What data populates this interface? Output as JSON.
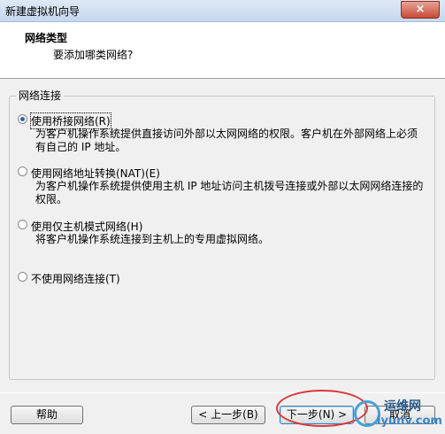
{
  "window": {
    "title": "新建虚拟机向导",
    "close_glyph": "×"
  },
  "header": {
    "title": "网络类型",
    "subtitle": "要添加哪类网络?"
  },
  "group": {
    "label": "网络连接"
  },
  "options": [
    {
      "label": "使用桥接网络(R)",
      "checked": true,
      "desc_lines": [
        "为客户机操作系统提供直接访问外部以太网网络的权限。客户机在外部网络上必须",
        "有自己的 IP 地址。"
      ]
    },
    {
      "label": "使用网络地址转换(NAT)(E)",
      "checked": false,
      "desc_lines": [
        "为客户机操作系统提供使用主机 IP 地址访问主机拨号连接或外部以太网网络连接的",
        "权限。"
      ]
    },
    {
      "label": "使用仅主机模式网络(H)",
      "checked": false,
      "desc_lines": [
        "将客户机操作系统连接到主机上的专用虚拟网络。"
      ]
    },
    {
      "label": "不使用网络连接(T)",
      "checked": false,
      "desc_lines": []
    }
  ],
  "buttons": {
    "help": "帮助",
    "back": "< 上一步(B)",
    "next": "下一步(N) >",
    "cancel": "取消"
  },
  "watermark": {
    "line1": "运维网",
    "line2": "iyunv.com"
  },
  "colors": {
    "annotation_circle": "#d93a3a",
    "radio_dot": "#2b63b8"
  }
}
